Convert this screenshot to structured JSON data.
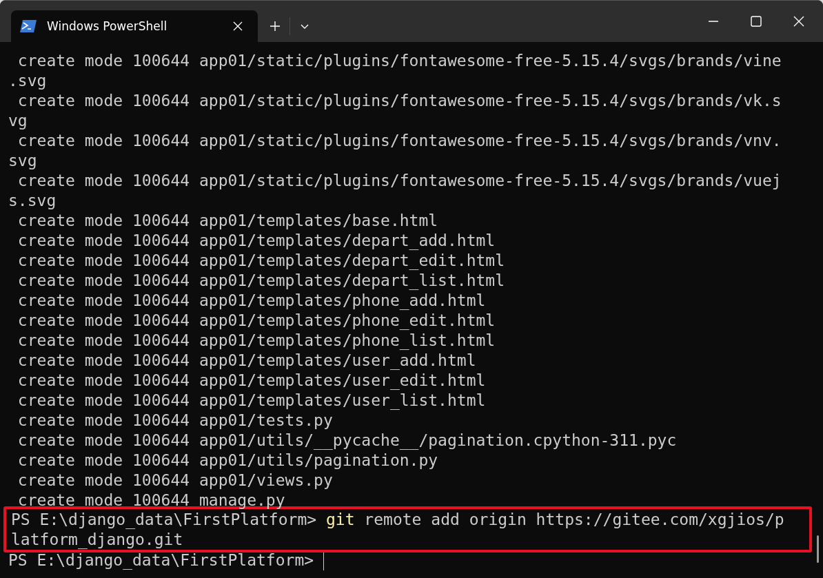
{
  "tabs": [
    {
      "title": "Windows PowerShell",
      "selected": true
    }
  ],
  "terminal": {
    "output_lines": [
      " create mode 100644 app01/static/plugins/fontawesome-free-5.15.4/svgs/brands/vine",
      ".svg",
      " create mode 100644 app01/static/plugins/fontawesome-free-5.15.4/svgs/brands/vk.s",
      "vg",
      " create mode 100644 app01/static/plugins/fontawesome-free-5.15.4/svgs/brands/vnv.",
      "svg",
      " create mode 100644 app01/static/plugins/fontawesome-free-5.15.4/svgs/brands/vuej",
      "s.svg",
      " create mode 100644 app01/templates/base.html",
      " create mode 100644 app01/templates/depart_add.html",
      " create mode 100644 app01/templates/depart_edit.html",
      " create mode 100644 app01/templates/depart_list.html",
      " create mode 100644 app01/templates/phone_add.html",
      " create mode 100644 app01/templates/phone_edit.html",
      " create mode 100644 app01/templates/phone_list.html",
      " create mode 100644 app01/templates/user_add.html",
      " create mode 100644 app01/templates/user_edit.html",
      " create mode 100644 app01/templates/user_list.html",
      " create mode 100644 app01/tests.py",
      " create mode 100644 app01/utils/__pycache__/pagination.cpython-311.pyc",
      " create mode 100644 app01/utils/pagination.py",
      " create mode 100644 app01/views.py",
      " create mode 100644 manage.py"
    ],
    "command_block": {
      "highlighted": true,
      "prompt": "PS E:\\django_data\\FirstPlatform> ",
      "command": "git",
      "arguments": " remote add origin https://gitee.com/xgjios/p",
      "continuation": "latform_django.git"
    },
    "current_prompt": "PS E:\\django_data\\FirstPlatform> "
  }
}
